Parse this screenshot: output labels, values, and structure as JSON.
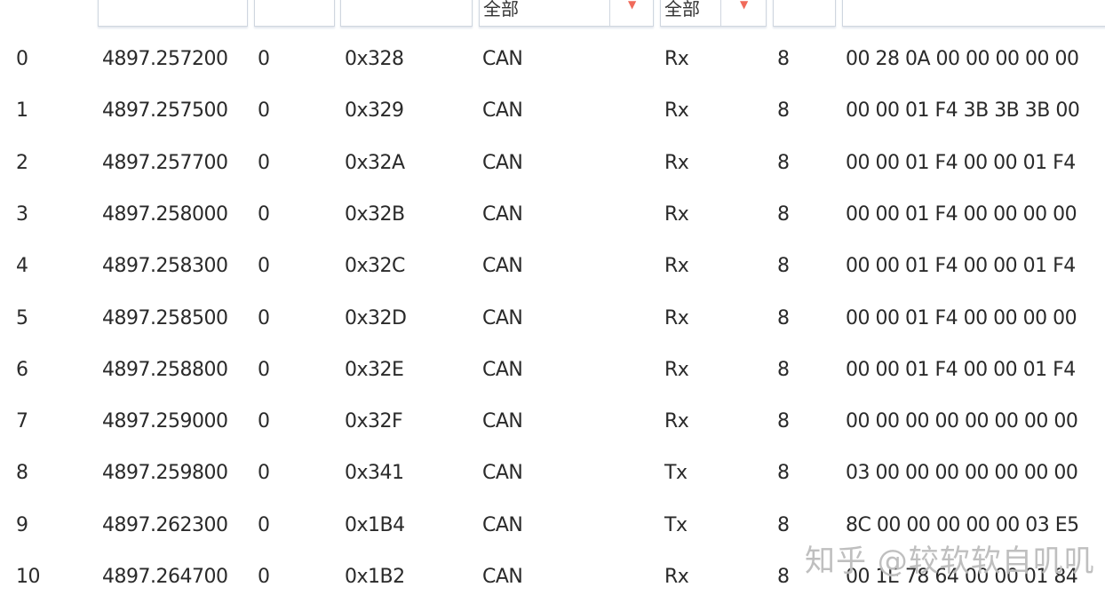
{
  "filters": {
    "type_filter": "全部",
    "dir_filter": "全部"
  },
  "rows": [
    {
      "index": "0",
      "time": "4897.257200",
      "channel": "0",
      "id": "0x328",
      "type": "CAN",
      "dir": "Rx",
      "dlc": "8",
      "data": "00 28 0A 00 00 00 00 00"
    },
    {
      "index": "1",
      "time": "4897.257500",
      "channel": "0",
      "id": "0x329",
      "type": "CAN",
      "dir": "Rx",
      "dlc": "8",
      "data": "00 00 01 F4 3B 3B 3B 00"
    },
    {
      "index": "2",
      "time": "4897.257700",
      "channel": "0",
      "id": "0x32A",
      "type": "CAN",
      "dir": "Rx",
      "dlc": "8",
      "data": "00 00 01 F4 00 00 01 F4"
    },
    {
      "index": "3",
      "time": "4897.258000",
      "channel": "0",
      "id": "0x32B",
      "type": "CAN",
      "dir": "Rx",
      "dlc": "8",
      "data": "00 00 01 F4 00 00 00 00"
    },
    {
      "index": "4",
      "time": "4897.258300",
      "channel": "0",
      "id": "0x32C",
      "type": "CAN",
      "dir": "Rx",
      "dlc": "8",
      "data": "00 00 01 F4 00 00 01 F4"
    },
    {
      "index": "5",
      "time": "4897.258500",
      "channel": "0",
      "id": "0x32D",
      "type": "CAN",
      "dir": "Rx",
      "dlc": "8",
      "data": "00 00 01 F4 00 00 00 00"
    },
    {
      "index": "6",
      "time": "4897.258800",
      "channel": "0",
      "id": "0x32E",
      "type": "CAN",
      "dir": "Rx",
      "dlc": "8",
      "data": "00 00 01 F4 00 00 01 F4"
    },
    {
      "index": "7",
      "time": "4897.259000",
      "channel": "0",
      "id": "0x32F",
      "type": "CAN",
      "dir": "Rx",
      "dlc": "8",
      "data": "00 00 00 00 00 00 00 00"
    },
    {
      "index": "8",
      "time": "4897.259800",
      "channel": "0",
      "id": "0x341",
      "type": "CAN",
      "dir": "Tx",
      "dlc": "8",
      "data": "03 00 00 00 00 00 00 00"
    },
    {
      "index": "9",
      "time": "4897.262300",
      "channel": "0",
      "id": "0x1B4",
      "type": "CAN",
      "dir": "Tx",
      "dlc": "8",
      "data": "8C 00 00 00 00 00 03 E5"
    },
    {
      "index": "10",
      "time": "4897.264700",
      "channel": "0",
      "id": "0x1B2",
      "type": "CAN",
      "dir": "Rx",
      "dlc": "8",
      "data": "00 1E 78 64 00 00 01 84"
    }
  ],
  "watermark": "知乎 @较软软自叽叽",
  "colors": {
    "dropdown_arrow": "#f06a5a",
    "border": "#cfd6df"
  }
}
